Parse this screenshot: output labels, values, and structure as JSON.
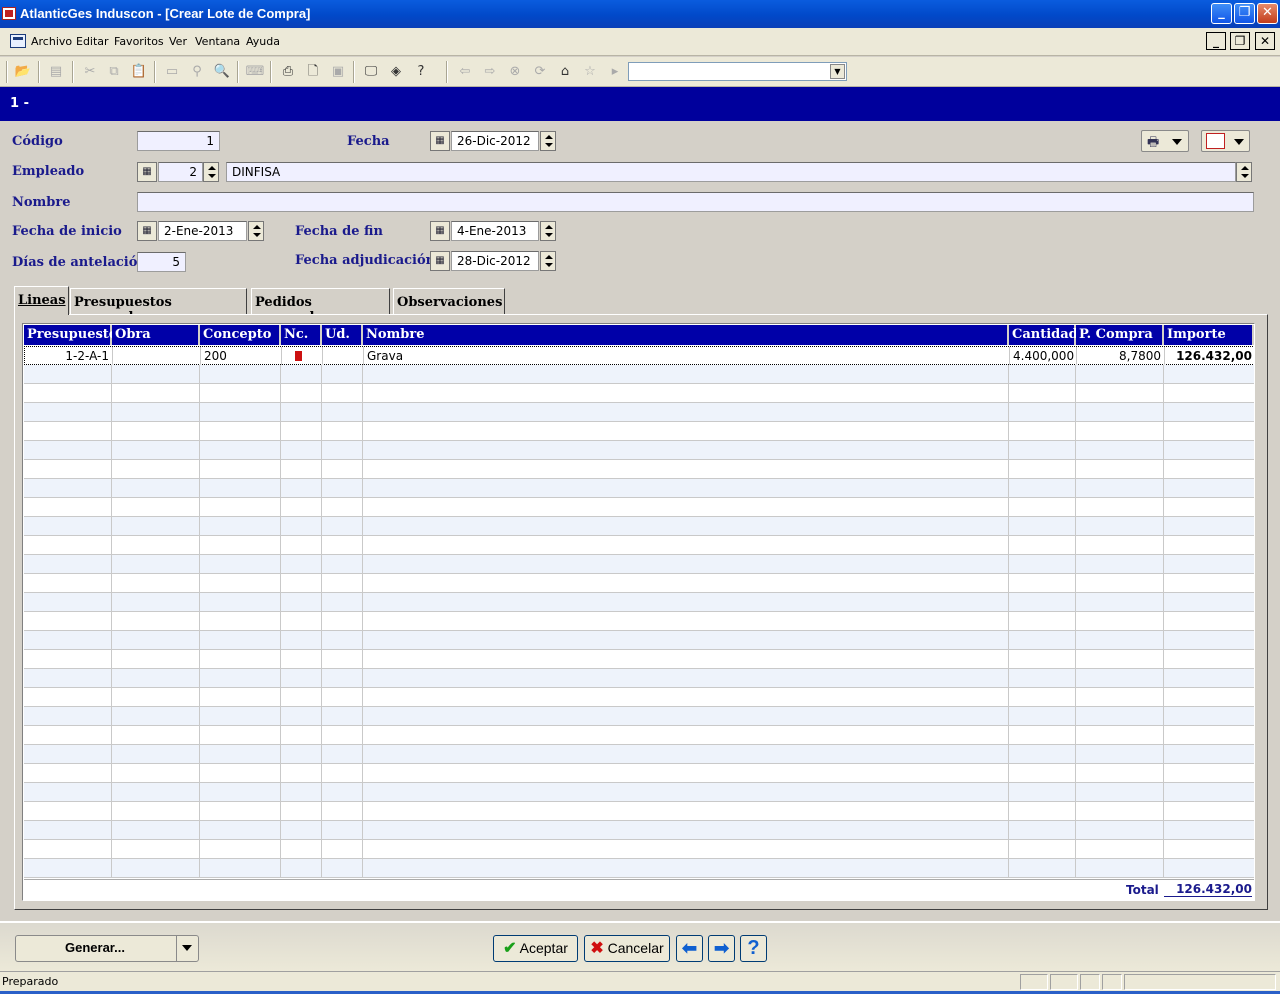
{
  "window": {
    "title": "AtlanticGes Induscon - [Crear Lote de Compra]"
  },
  "menu": {
    "items": [
      "Archivo",
      "Editar",
      "Favoritos",
      "Ver",
      "Ventana",
      "Ayuda"
    ]
  },
  "header": {
    "title": "1 -"
  },
  "form": {
    "codigo": {
      "label": "Código",
      "value": "1"
    },
    "fecha": {
      "label": "Fecha",
      "value": "26-Dic-2012"
    },
    "empleado": {
      "label": "Empleado",
      "code": "2",
      "name": "DINFISA"
    },
    "nombre": {
      "label": "Nombre",
      "value": ""
    },
    "fecha_inicio": {
      "label": "Fecha de inicio",
      "value": "2-Ene-2013"
    },
    "fecha_fin": {
      "label": "Fecha de fin",
      "value": "4-Ene-2013"
    },
    "dias_antelacion": {
      "label": "Días de antelación",
      "value": "5"
    },
    "fecha_adjudicacion": {
      "label": "Fecha adjudicación",
      "value": "28-Dic-2012"
    }
  },
  "tabs": [
    "Lineas",
    "Presupuestos generados",
    "Pedidos generados",
    "Observaciones"
  ],
  "grid": {
    "columns": [
      "Presupuesto",
      "Obra",
      "Concepto",
      "Nc.",
      "Ud.",
      "Nombre",
      "Cantidad",
      "P. Compra",
      "Importe"
    ],
    "rows": [
      {
        "presupuesto": "1-2-A-1",
        "obra": "",
        "concepto": "200",
        "nc": "red-doc-icon",
        "ud": "",
        "nombre": "Grava",
        "cantidad": "4.400,000",
        "p_compra": "8,7800",
        "importe": "126.432,00"
      }
    ],
    "total_label": "Total",
    "total_value": "126.432,00"
  },
  "buttons": {
    "generar": "Generar...",
    "aceptar": "Aceptar",
    "cancelar": "Cancelar",
    "help": "?"
  },
  "status": {
    "text": "Preparado"
  },
  "colors": {
    "header_band": "#00009c",
    "grid_header": "#0000a8",
    "label": "#1a1a8c",
    "title_bar": "#0149c9"
  }
}
